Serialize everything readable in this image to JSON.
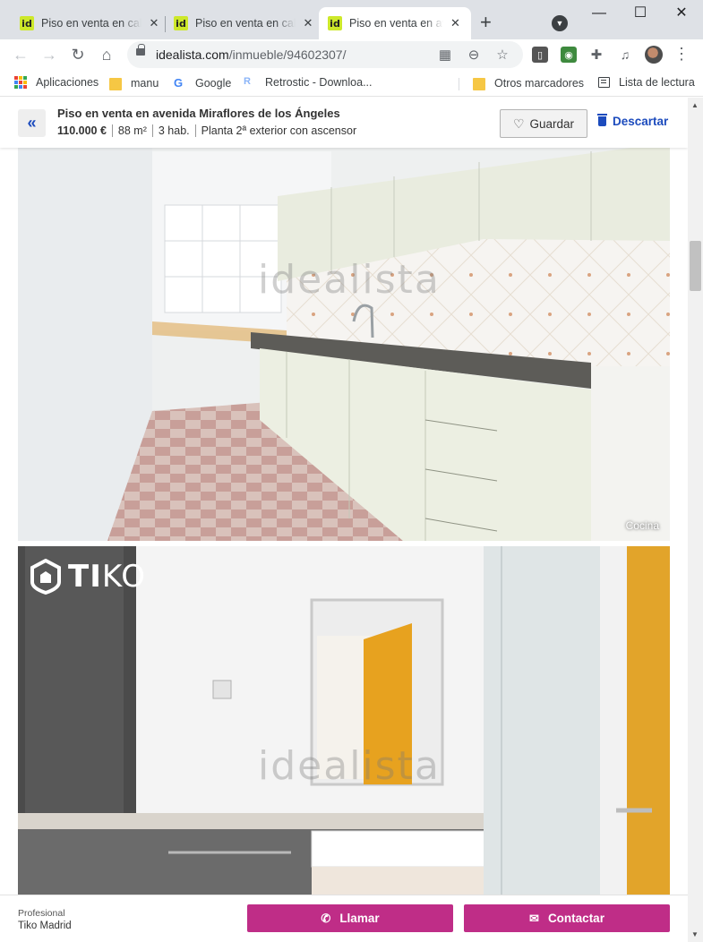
{
  "browser": {
    "tabs": [
      {
        "label": "Piso en venta en calle",
        "favicon": "id",
        "active": false
      },
      {
        "label": "Piso en venta en calle",
        "favicon": "id",
        "active": false
      },
      {
        "label": "Piso en venta en avenida",
        "favicon": "id",
        "active": true
      }
    ],
    "new_tab": "+",
    "url_domain": "idealista.com",
    "url_path": "/inmueble/94602307/",
    "bookmarks": [
      {
        "label": "Aplicaciones",
        "icon": "apps-grid-icon"
      },
      {
        "label": "manu",
        "icon": "folder-icon"
      },
      {
        "label": "Google",
        "icon": "google-icon"
      },
      {
        "label": "Retrostic - Downloa...",
        "icon": "retrostic-icon"
      },
      {
        "label": "Otros marcadores",
        "icon": "folder-icon"
      },
      {
        "label": "Lista de lectura",
        "icon": "reading-list-icon"
      }
    ]
  },
  "property": {
    "title": "Piso en venta en avenida Miraflores de los Ángeles",
    "price": "110.000 €",
    "size": "88 m²",
    "rooms": "3 hab.",
    "floor": "Planta 2ª exterior con ascensor",
    "save_label": "Guardar",
    "discard_label": "Descartar"
  },
  "gallery": {
    "watermark": "idealista",
    "brand_logo_bold": "TI",
    "brand_logo_light": "KO",
    "photos": [
      {
        "caption": "Cocina"
      },
      {
        "caption": ""
      }
    ]
  },
  "contact": {
    "type": "Profesional",
    "agency": "Tiko Madrid",
    "call_label": "Llamar",
    "contact_label": "Contactar"
  },
  "colors": {
    "accent_blue": "#1c4bbd",
    "cta_magenta": "#bf2d87",
    "favicon_lime": "#cde82a"
  }
}
